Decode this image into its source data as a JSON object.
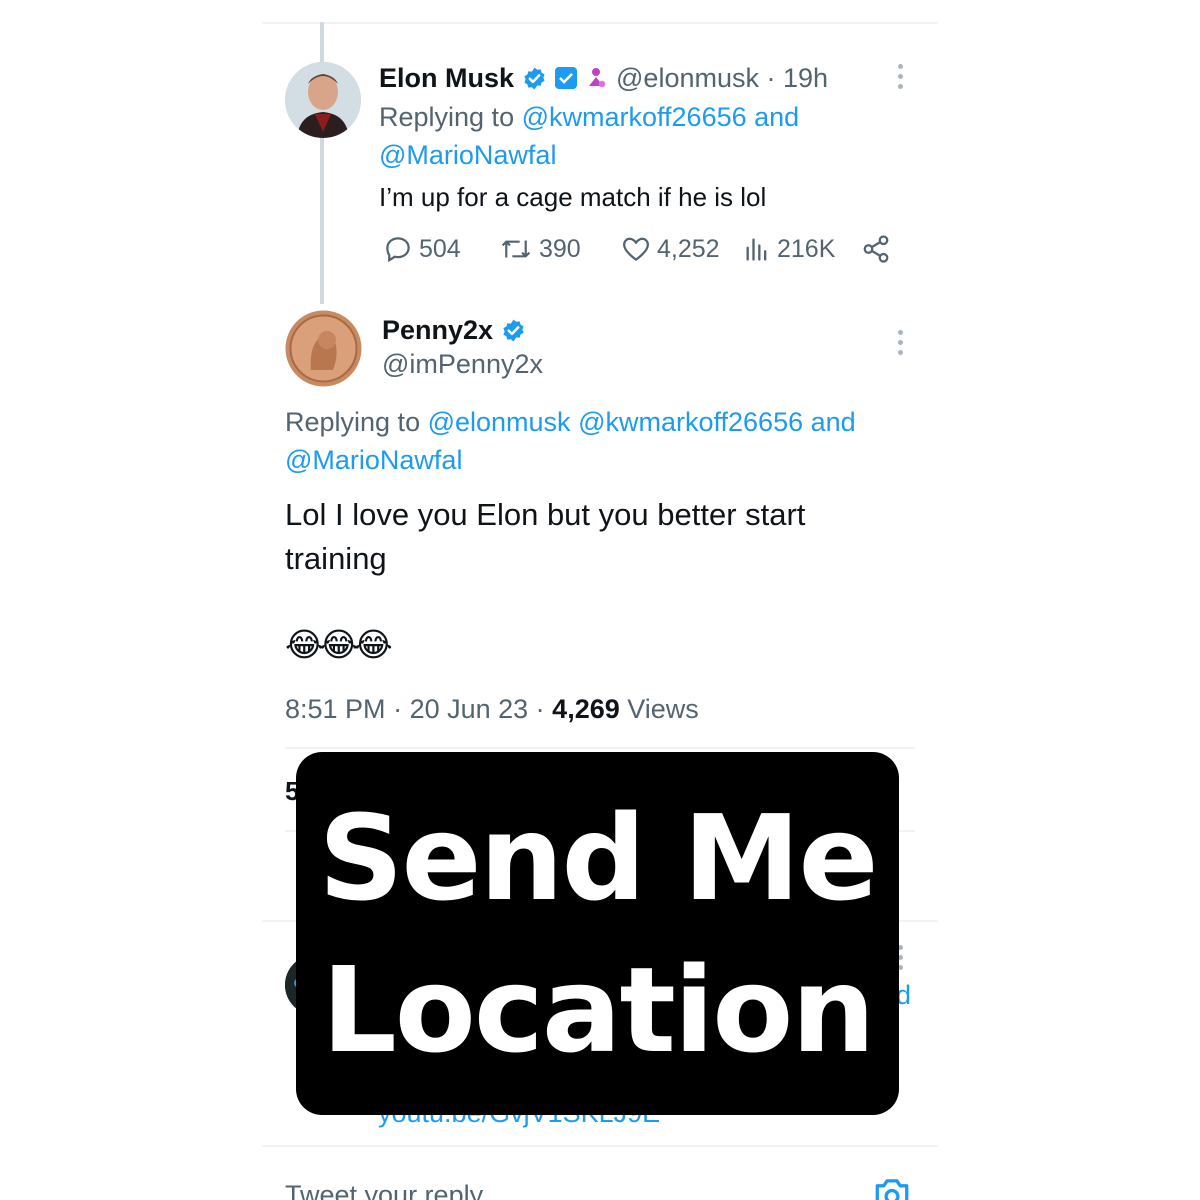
{
  "elon_tweet": {
    "name": "Elon Musk",
    "handle": "@elonmusk",
    "separator": " · ",
    "time": "19h",
    "replying_prefix": "Replying to ",
    "replying_user1": "@kwmarkoff26656",
    "replying_and": " and",
    "replying_user2": "@MarioNawfal",
    "text": "I’m up for a cage match if he is lol",
    "stats": {
      "replies": "504",
      "retweets": "390",
      "likes": "4,252",
      "views": "216K"
    }
  },
  "penny_tweet": {
    "name": "Penny2x",
    "handle": "@imPenny2x",
    "replying_prefix": "Replying to ",
    "replying_user1": "@elonmusk",
    "replying_user2": "@kwmarkoff26656",
    "replying_and": " and",
    "replying_user3": "@MarioNawfal",
    "text_line1": "Lol I love you Elon but you better start",
    "text_line2": "training",
    "emojis": "😂😂😂",
    "time": "8:51 PM",
    "dot1": " · ",
    "date": "20 Jun 23",
    "dot2": " · ",
    "views_count": "4,269",
    "views_label": " Views"
  },
  "partial": {
    "stat_digit": "5",
    "right_char": "d",
    "link": "youtu.be/GvjV1SKLJ9E"
  },
  "reply_bar": {
    "placeholder": "Tweet your reply"
  },
  "overlay": {
    "line1": "Send Me",
    "line2": "Location"
  },
  "colors": {
    "accent": "#1d9bf0",
    "text": "#0f1419",
    "muted": "#536471",
    "overlay_bg": "#000000"
  },
  "icons": [
    "verified-icon",
    "twitter-square-icon",
    "community-icon",
    "reply-icon",
    "retweet-icon",
    "like-icon",
    "views-icon",
    "share-icon",
    "more-icon",
    "camera-icon"
  ]
}
